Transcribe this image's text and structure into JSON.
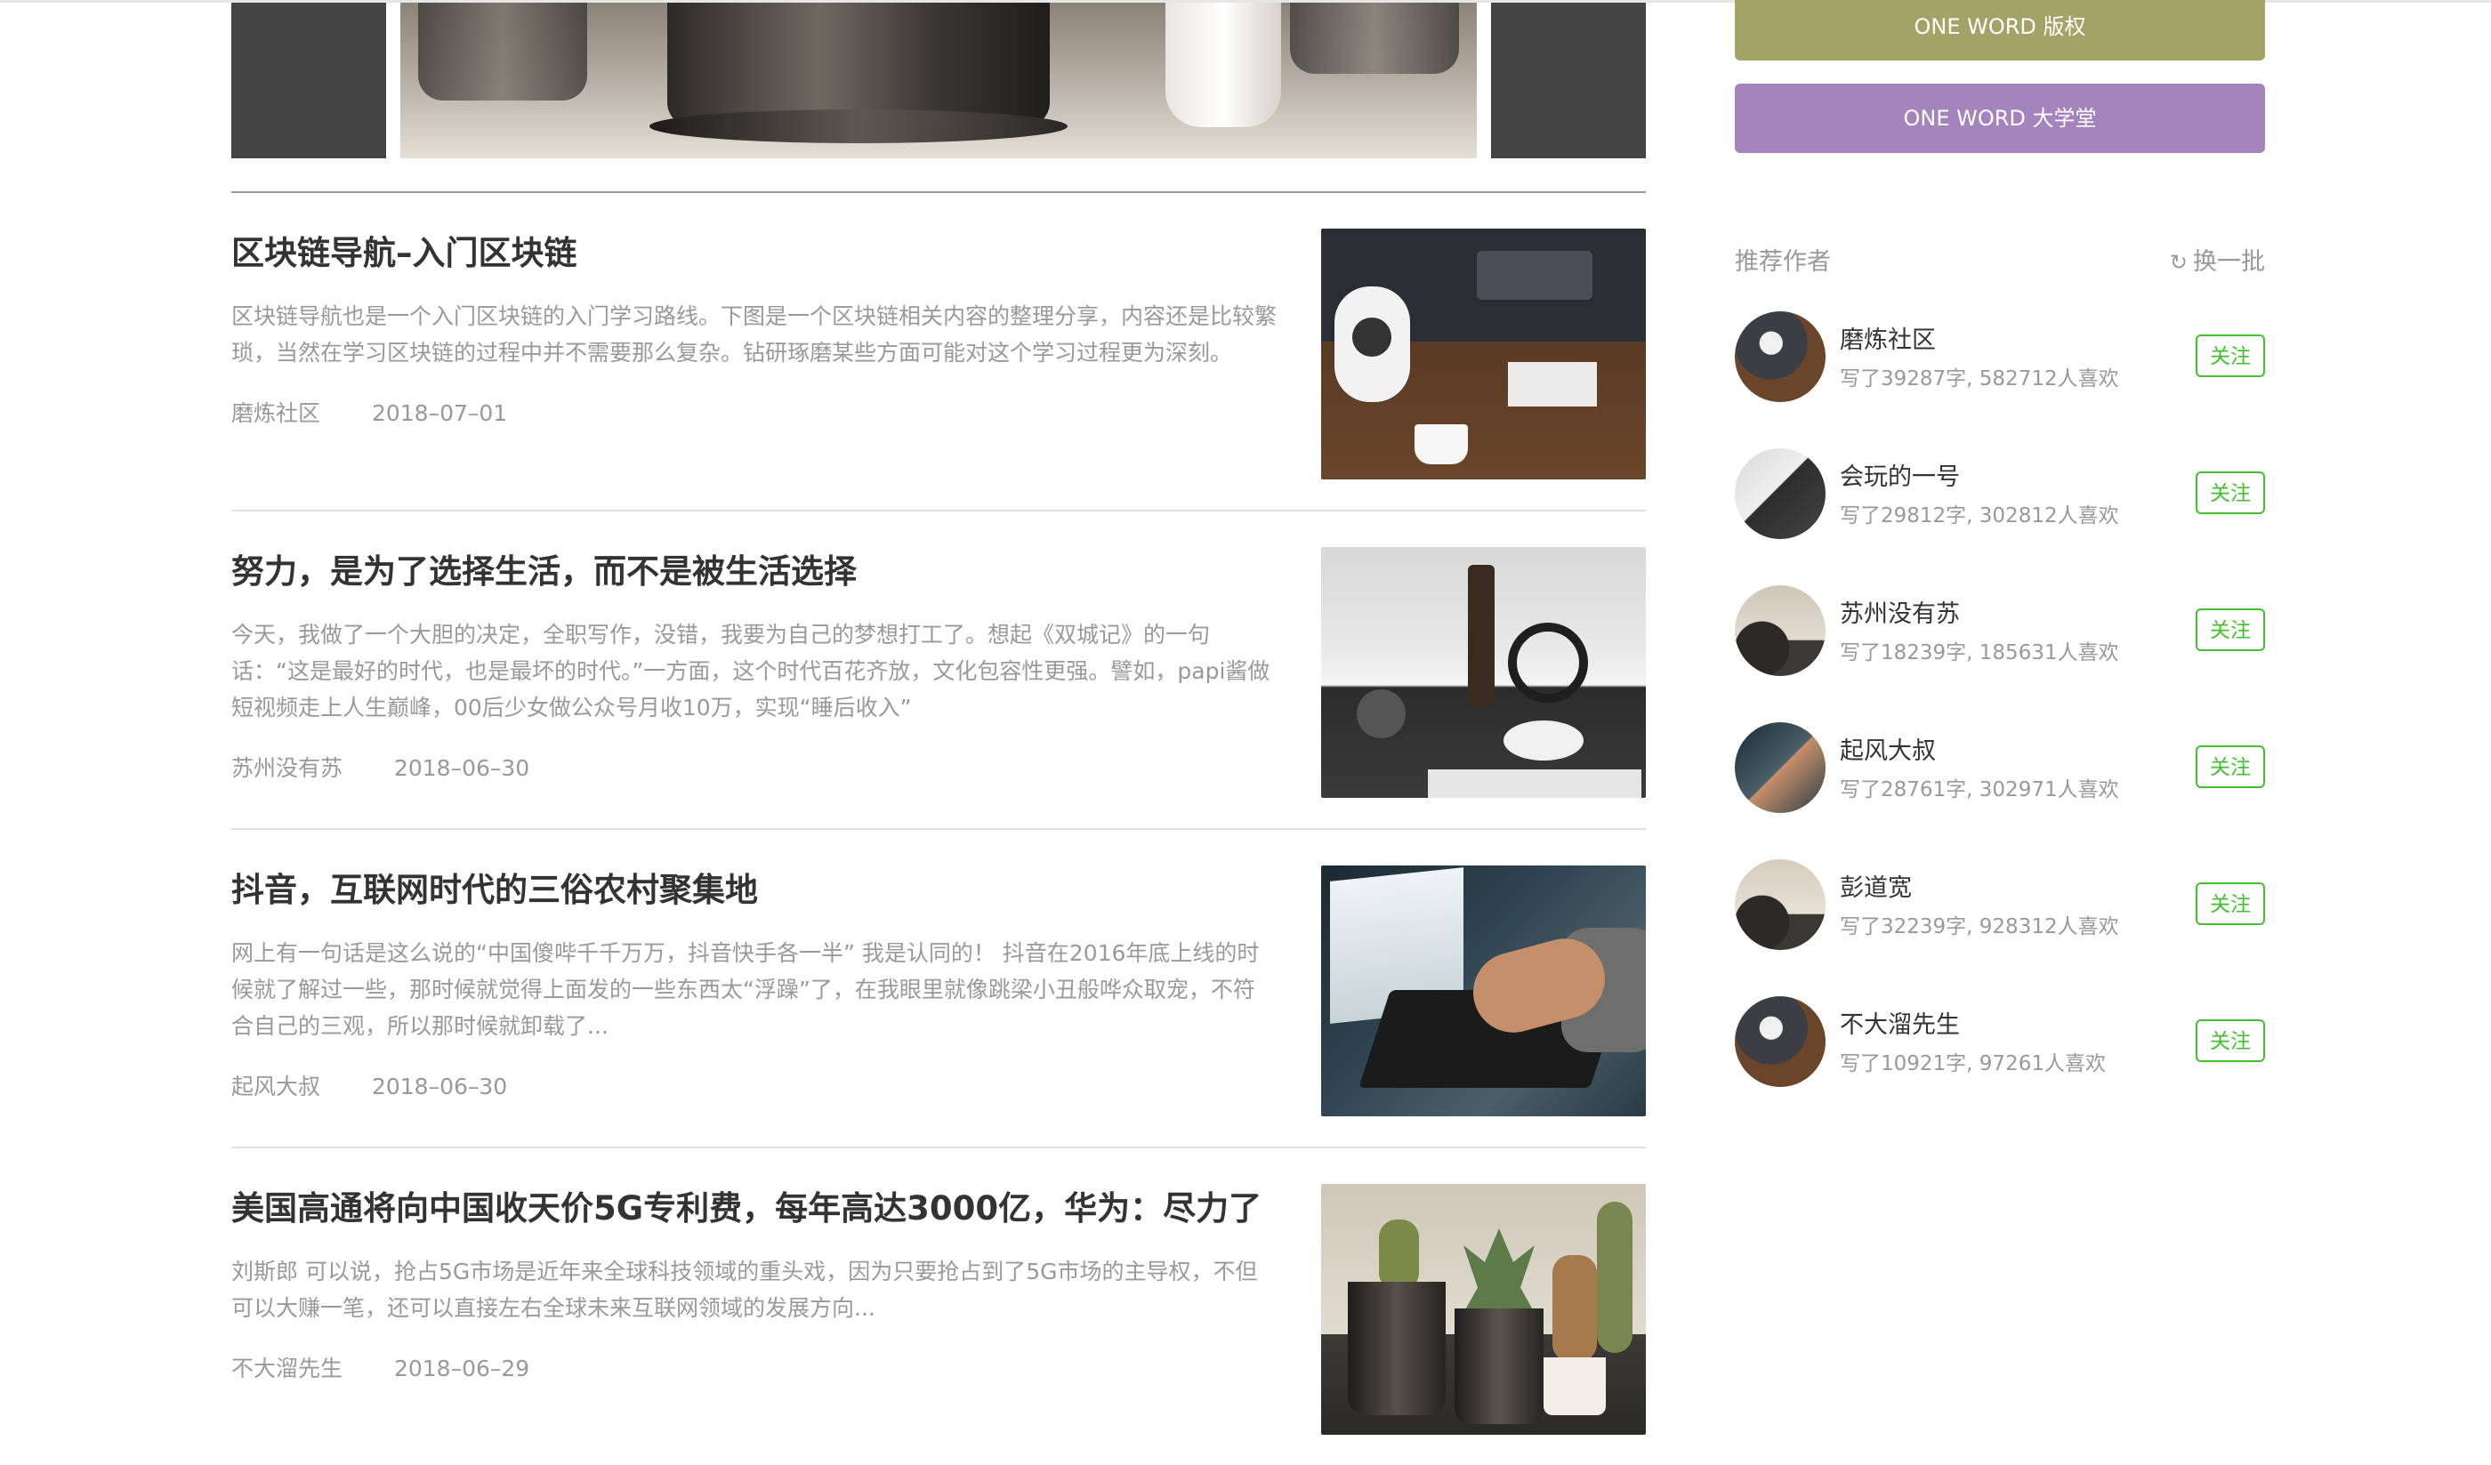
{
  "sidebar": {
    "buttons": [
      {
        "label": "ONE WORD 版权",
        "color": "#a4a367"
      },
      {
        "label": "ONE WORD 大学堂",
        "color": "#a584bd"
      }
    ],
    "recommend": {
      "title": "推荐作者",
      "refresh_label": "换一批",
      "refresh_icon": "refresh-icon"
    },
    "authors": [
      {
        "name": "磨炼社区",
        "stats": "写了39287字, 582712人喜欢",
        "follow": "关注"
      },
      {
        "name": "会玩的一号",
        "stats": "写了29812字, 302812人喜欢",
        "follow": "关注"
      },
      {
        "name": "苏州没有苏",
        "stats": "写了18239字, 185631人喜欢",
        "follow": "关注"
      },
      {
        "name": "起风大叔",
        "stats": "写了28761字, 302971人喜欢",
        "follow": "关注"
      },
      {
        "name": "彭道宽",
        "stats": "写了32239字, 928312人喜欢",
        "follow": "关注"
      },
      {
        "name": "不大溜先生",
        "stats": "写了10921字, 97261人喜欢",
        "follow": "关注"
      }
    ]
  },
  "articles": [
    {
      "title": "区块链导航–入门区块链",
      "abstract": "区块链导航也是一个入门区块链的入门学习路线。下图是一个区块链相关内容的整理分享，内容还是比较繁琐，当然在学习区块链的过程中并不需要那么复杂。钻研琢磨某些方面可能对这个学习过程更为深刻。",
      "author": "磨炼社区",
      "date": "2018–07–01"
    },
    {
      "title": "努力，是为了选择生活，而不是被生活选择",
      "abstract": "今天，我做了一个大胆的决定，全职写作，没错，我要为自己的梦想打工了。想起《双城记》的一句话：“这是最好的时代，也是最坏的时代。”一方面，这个时代百花齐放，文化包容性更强。譬如，papi酱做短视频走上人生巅峰，00后少女做公众号月收10万，实现“睡后收入”",
      "author": "苏州没有苏",
      "date": "2018–06–30"
    },
    {
      "title": "抖音，互联网时代的三俗农村聚集地",
      "abstract": "网上有一句话是这么说的“中国傻哔千千万万，抖音快手各一半” 我是认同的！ 抖音在2016年底上线的时候就了解过一些，那时候就觉得上面发的一些东西太“浮躁”了，在我眼里就像跳梁小丑般哗众取宠，不符合自己的三观，所以那时候就卸载了...",
      "author": "起风大叔",
      "date": "2018–06–30"
    },
    {
      "title": "美国高通将向中国收天价5G专利费，每年高达3000亿，华为：尽力了",
      "abstract": "刘斯郎 可以说，抢占5G市场是近年来全球科技领域的重头戏，因为只要抢占到了5G市场的主导权，不但可以大赚一笔，还可以直接左右全球未来互联网领域的发展方向...",
      "author": "不大溜先生",
      "date": "2018–06–29"
    }
  ],
  "colors": {
    "follow_green": "#42c02e",
    "muted_text": "#999999",
    "title_text": "#333333"
  }
}
